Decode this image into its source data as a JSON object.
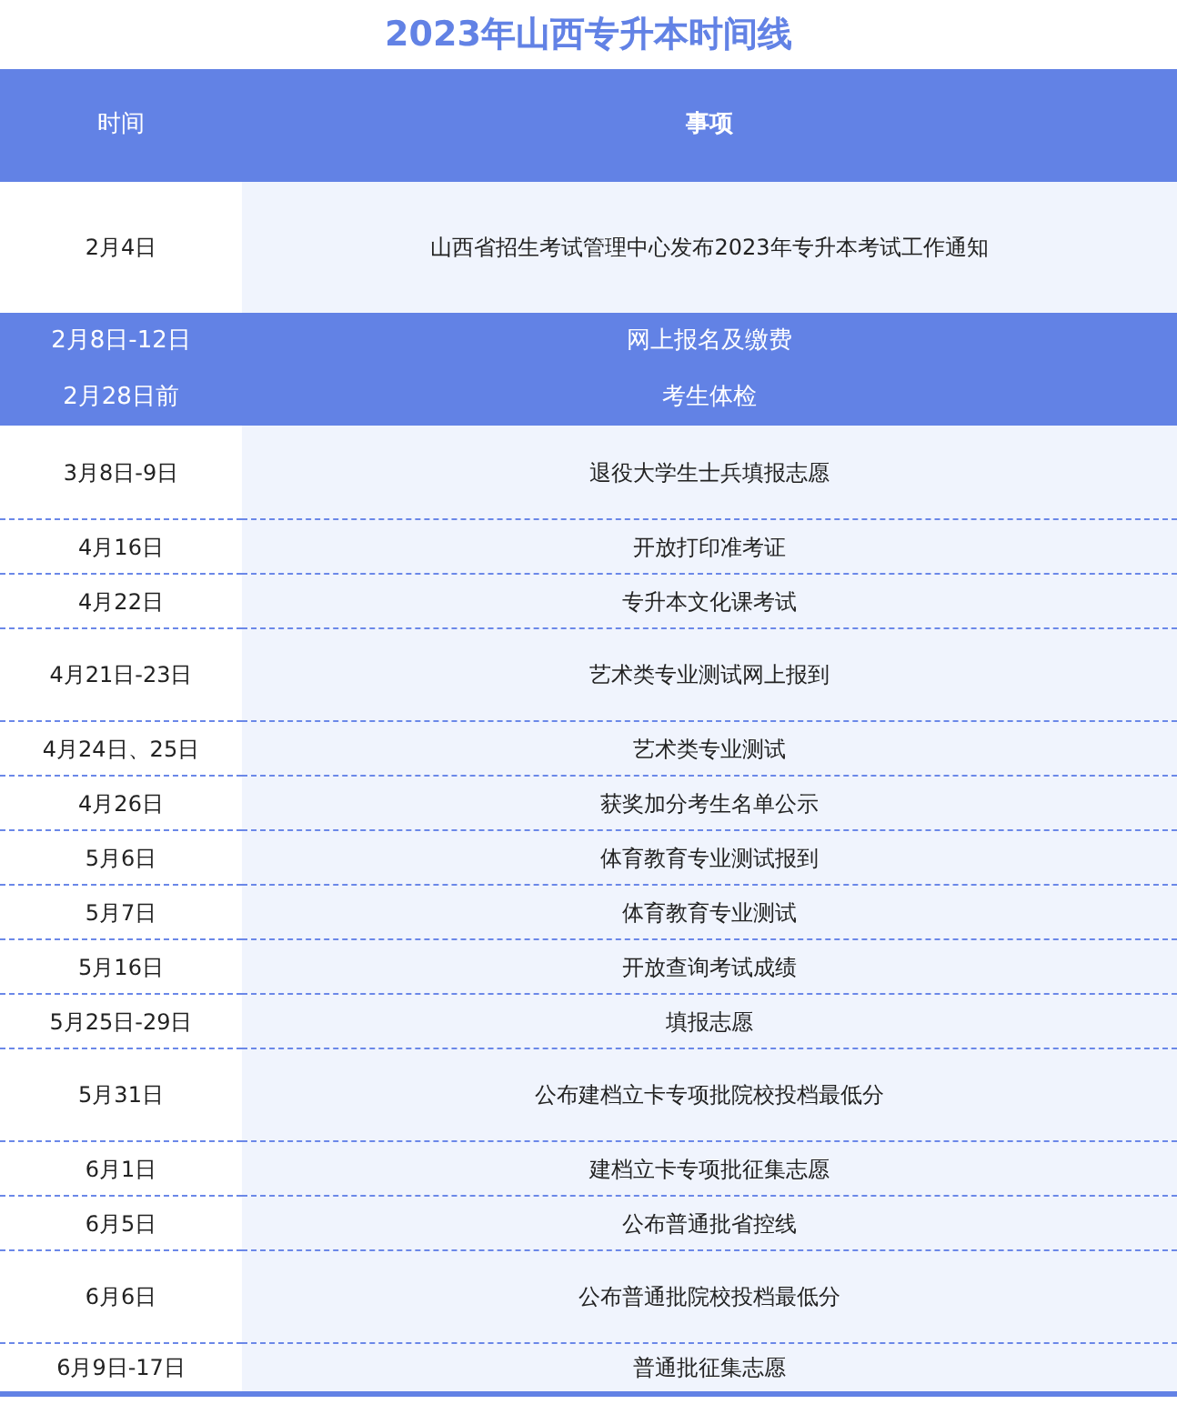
{
  "title": "2023年山西专升本时间线",
  "columns": [
    "时间",
    "事项"
  ],
  "rows": [
    {
      "date": "2月4日",
      "event": "山西省招生考试管理中心发布2023年专升本考试工作通知",
      "highlighted": false,
      "tall": true
    },
    {
      "date": "2月8日-12日",
      "event": "网上报名及缴费",
      "highlighted": true,
      "tall": false
    },
    {
      "date": "2月28日前",
      "event": "考生体检",
      "highlighted": true,
      "tall": false
    },
    {
      "date": "3月8日-9日",
      "event": "退役大学生士兵填报志愿",
      "highlighted": false,
      "tall": true
    },
    {
      "date": "4月16日",
      "event": "开放打印准考证",
      "highlighted": false,
      "tall": false
    },
    {
      "date": "4月22日",
      "event": "专升本文化课考试",
      "highlighted": false,
      "tall": false
    },
    {
      "date": "4月21日-23日",
      "event": "艺术类专业测试网上报到",
      "highlighted": false,
      "tall": true
    },
    {
      "date": "4月24日、25日",
      "event": "艺术类专业测试",
      "highlighted": false,
      "tall": false
    },
    {
      "date": "4月26日",
      "event": "获奖加分考生名单公示",
      "highlighted": false,
      "tall": false
    },
    {
      "date": "5月6日",
      "event": "体育教育专业测试报到",
      "highlighted": false,
      "tall": false
    },
    {
      "date": "5月7日",
      "event": "体育教育专业测试",
      "highlighted": false,
      "tall": false
    },
    {
      "date": "5月16日",
      "event": "开放查询考试成绩",
      "highlighted": false,
      "tall": false
    },
    {
      "date": "5月25日-29日",
      "event": "填报志愿",
      "highlighted": false,
      "tall": false
    },
    {
      "date": "5月31日",
      "event": "公布建档立卡专项批院校投档最低分",
      "highlighted": false,
      "tall": true
    },
    {
      "date": "6月1日",
      "event": "建档立卡专项批征集志愿",
      "highlighted": false,
      "tall": false
    },
    {
      "date": "6月5日",
      "event": "公布普通批省控线",
      "highlighted": false,
      "tall": false
    },
    {
      "date": "6月6日",
      "event": "公布普通批院校投档最低分",
      "highlighted": false,
      "tall": true
    },
    {
      "date": "6月9日-17日",
      "event": "普通批征集志愿",
      "highlighted": false,
      "tall": false
    }
  ]
}
